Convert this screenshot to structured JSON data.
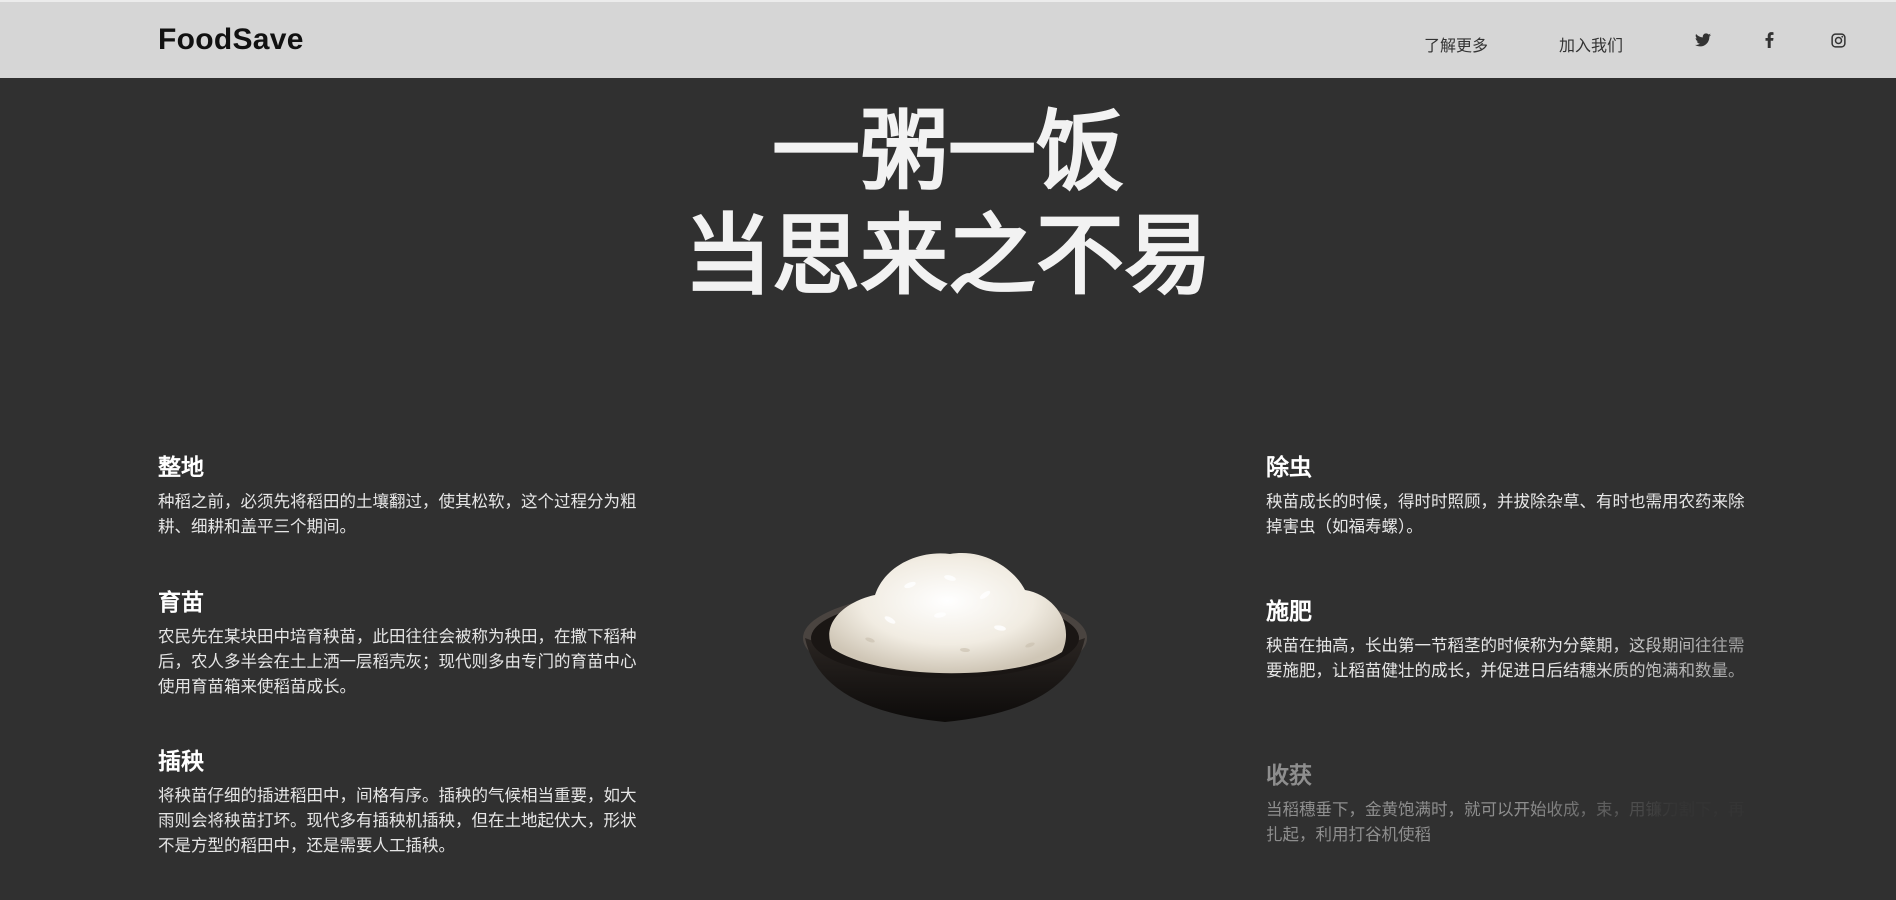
{
  "nav": {
    "logo": "FoodSave",
    "links": [
      "了解更多",
      "加入我们"
    ],
    "social_icons": [
      "twitter-icon",
      "facebook-icon",
      "instagram-icon"
    ]
  },
  "hero": {
    "line1": "一粥一饭",
    "line2": "当思来之不易"
  },
  "steps_left": [
    {
      "title": "整地",
      "text": "种稻之前，必须先将稻田的土壤翻过，使其松软，这个过程分为粗耕、细耕和盖平三个期间。"
    },
    {
      "title": "育苗",
      "text": "农民先在某块田中培育秧苗，此田往往会被称为秧田，在撒下稻种后，农人多半会在土上洒一层稻壳灰；现代则多由专门的育苗中心使用育苗箱来使稻苗成长。"
    },
    {
      "title": "插秧",
      "text": "将秧苗仔细的插进稻田中，间格有序。插秧的气候相当重要，如大雨则会将秧苗打坏。现代多有插秧机插秧，但在土地起伏大，形状不是方型的稻田中，还是需要人工插秧。"
    }
  ],
  "steps_right": [
    {
      "title": "除虫",
      "text": "秧苗成长的时候，得时时照顾，并拔除杂草、有时也需用农药来除掉害虫（如福寿螺）。"
    },
    {
      "title": "施肥",
      "text": "秧苗在抽高，长出第一节稻茎的时候称为分蘖期，这段期间往往需要施肥，让稻苗健壮的成长，并促进日后结穗米质的饱满和数量。"
    },
    {
      "title": "收获",
      "text": "当稻穗垂下，金黄饱满时，就可以开始收成，束，用镰刀割下，再扎起，利用打谷机使稻"
    }
  ],
  "colors": {
    "background": "#303030",
    "navbar": "#d6d6d6",
    "text": "#ffffff"
  }
}
